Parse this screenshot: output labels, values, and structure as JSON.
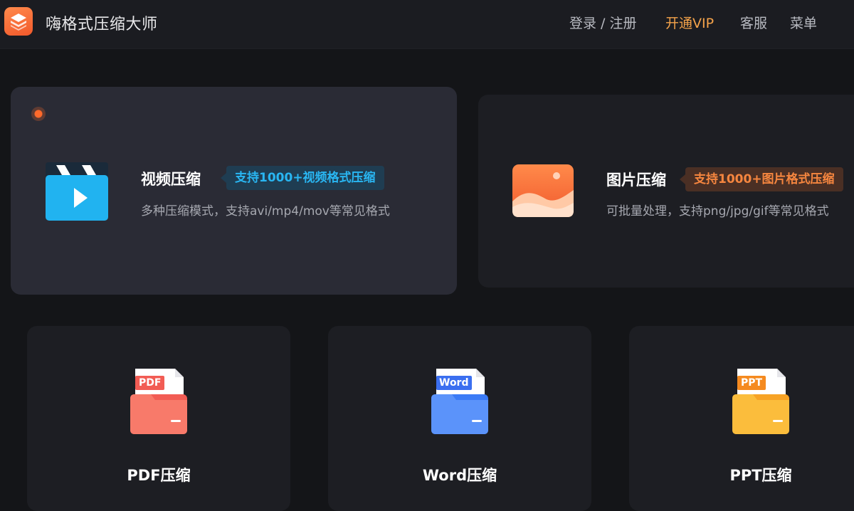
{
  "header": {
    "app_title": "嗨格式压缩大师",
    "nav": {
      "login": "登录 / 注册",
      "vip": "开通VIP",
      "service": "客服",
      "menu": "菜单"
    }
  },
  "features": {
    "video": {
      "title": "视频压缩",
      "tag": "支持1000+视频格式压缩",
      "desc": "多种压缩模式，支持avi/mp4/mov等常见格式"
    },
    "image": {
      "title": "图片压缩",
      "tag": "支持1000+图片格式压缩",
      "desc": "可批量处理，支持png/jpg/gif等常见格式"
    }
  },
  "tools": [
    {
      "label": "PDF压缩",
      "badge": "PDF"
    },
    {
      "label": "Word压缩",
      "badge": "Word"
    },
    {
      "label": "PPT压缩",
      "badge": "PPT"
    }
  ],
  "colors": {
    "accent_orange": "#f6863f",
    "accent_blue": "#29b6f2",
    "vip": "#f5a34a",
    "pdf": "#f25c54",
    "word": "#3b7bf6",
    "ppt": "#f7a325"
  }
}
